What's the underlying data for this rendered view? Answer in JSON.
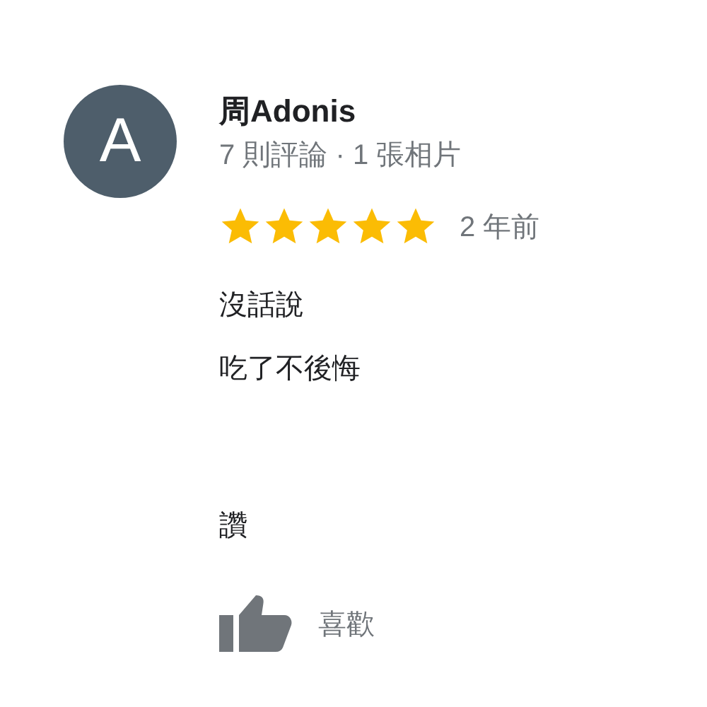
{
  "review": {
    "avatar_letter": "A",
    "author": "周Adonis",
    "meta": "7 則評論 · 1 張相片",
    "stars": 5,
    "time": "2 年前",
    "paragraphs": [
      [
        "沒話說",
        "吃了不後悔"
      ],
      [
        "讚"
      ]
    ],
    "like_label": "喜歡"
  }
}
